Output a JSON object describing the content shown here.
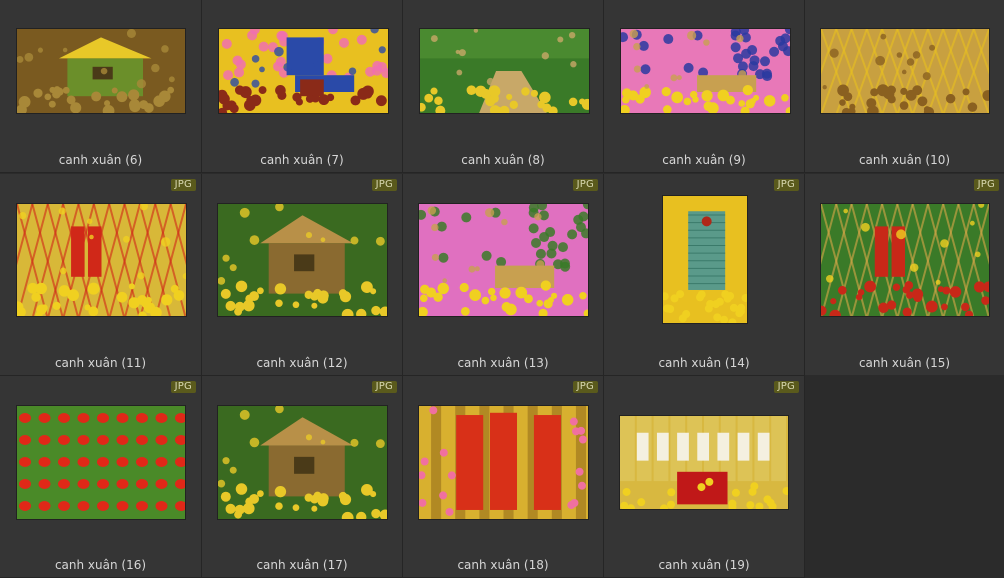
{
  "badge_label": "JPG",
  "items": [
    {
      "caption": "canh xuân (6)",
      "badge": false,
      "scene": "hut-yellow",
      "colors": [
        "#7a5a20",
        "#e8c828",
        "#a88838",
        "#6b8f2a"
      ]
    },
    {
      "caption": "canh xuân (7)",
      "badge": false,
      "scene": "pink-wall",
      "colors": [
        "#e8c020",
        "#f070b0",
        "#2a4aa8",
        "#8a2a18"
      ]
    },
    {
      "caption": "canh xuân (8)",
      "badge": false,
      "scene": "garden",
      "colors": [
        "#3a7a28",
        "#e8c828",
        "#c8a868",
        "#a88838"
      ]
    },
    {
      "caption": "canh xuân (9)",
      "badge": false,
      "scene": "pink-bench",
      "colors": [
        "#e878b8",
        "#2a3aa0",
        "#c8a050",
        "#f0d020"
      ]
    },
    {
      "caption": "canh xuân (10)",
      "badge": false,
      "scene": "lattice",
      "colors": [
        "#c8a040",
        "#e8c020",
        "#8a6020",
        "#f0d830"
      ]
    },
    {
      "caption": "canh xuân (11)",
      "badge": true,
      "scene": "bamboo-red",
      "colors": [
        "#d8b838",
        "#d02818",
        "#f0d020",
        "#6a7a28"
      ]
    },
    {
      "caption": "canh xuân (12)",
      "badge": true,
      "scene": "hut-green",
      "colors": [
        "#3a6a20",
        "#b89048",
        "#e8c828",
        "#8a6a30"
      ]
    },
    {
      "caption": "canh xuân (13)",
      "badge": true,
      "scene": "pink-bench",
      "colors": [
        "#e070c0",
        "#3a7a28",
        "#c8a050",
        "#f0d020"
      ]
    },
    {
      "caption": "canh xuân (14)",
      "badge": true,
      "scene": "door",
      "colors": [
        "#e8c020",
        "#5a9a8a",
        "#f0d020",
        "#8a6a20"
      ]
    },
    {
      "caption": "canh xuân (15)",
      "badge": true,
      "scene": "lattice-red",
      "colors": [
        "#3a7a28",
        "#d8a848",
        "#c82818",
        "#f0d020"
      ]
    },
    {
      "caption": "canh xuân (16)",
      "badge": true,
      "scene": "lanterns",
      "colors": [
        "#4a8a28",
        "#e02818",
        "#c8a030",
        "#2a5a18"
      ]
    },
    {
      "caption": "canh xuân (17)",
      "badge": true,
      "scene": "hut-green",
      "colors": [
        "#3a6a20",
        "#b89048",
        "#e8c828",
        "#8a6a30"
      ]
    },
    {
      "caption": "canh xuân (18)",
      "badge": true,
      "scene": "scrolls",
      "colors": [
        "#d8b030",
        "#d83018",
        "#f070a0",
        "#a88020"
      ]
    },
    {
      "caption": "canh xuân (19)",
      "badge": true,
      "scene": "table",
      "colors": [
        "#d8b840",
        "#c01818",
        "#f0d020",
        "#ffffff"
      ]
    }
  ]
}
